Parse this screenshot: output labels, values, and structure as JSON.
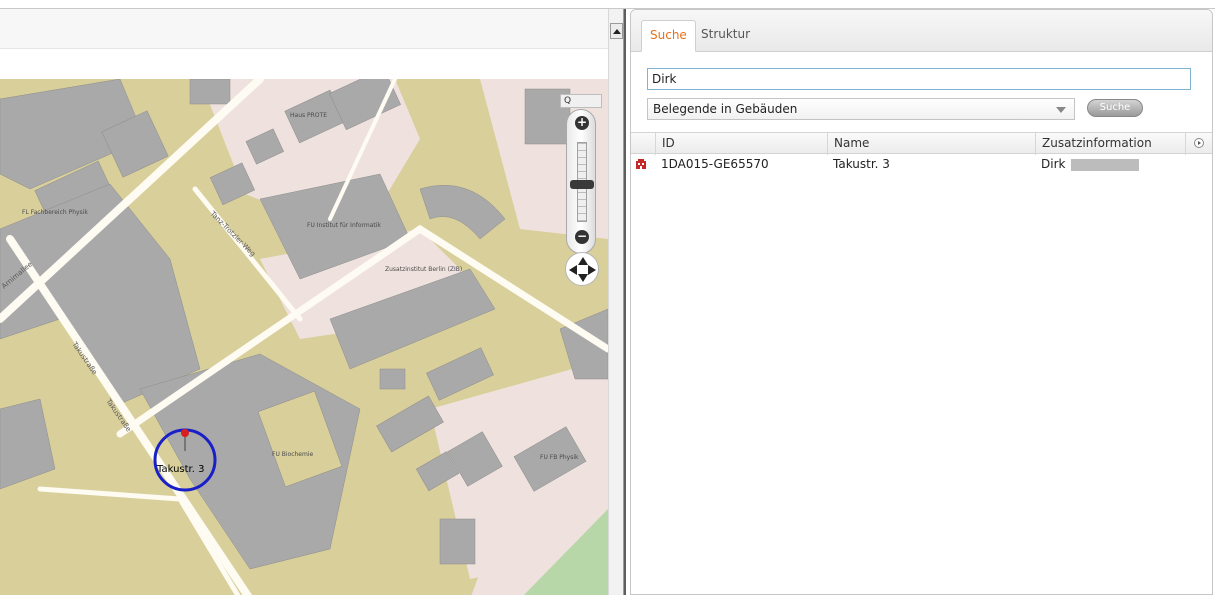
{
  "tabs": [
    {
      "label": "Suche",
      "active": true
    },
    {
      "label": "Struktur",
      "active": false
    }
  ],
  "search": {
    "value": "Dirk",
    "placeholder": ""
  },
  "filter": {
    "selected": "Belegende in Gebäuden"
  },
  "search_button": {
    "label": "Suche"
  },
  "results": {
    "columns": [
      "ID",
      "Name",
      "Zusatzinformation"
    ],
    "rows": [
      {
        "id": "1DA015-GE65570",
        "name": "Takustr. 3",
        "info": "Dirk"
      }
    ]
  },
  "map": {
    "zoom_search_label": "Q",
    "marker_label": "Takustr. 3",
    "building_labels": [
      "Haus PROTE",
      "FL Fachbereich Physik",
      "FU Institut für Informatik",
      "Zusatzinstitut Berlin (ZIB)",
      "FU Biochemie",
      "FU FB Physik"
    ],
    "street_labels": [
      "Arnimallee",
      "Takustraße",
      "Takustraße",
      "Tanz-Trotzler-Weg"
    ],
    "colors": {
      "land": "#d9cf9b",
      "building": "#a9a9a9",
      "road": "#fdfbf2",
      "marker_circle": "#1a20c8"
    }
  },
  "colors": {
    "accent": "#e8701a",
    "input_border": "#7fb3d6"
  }
}
